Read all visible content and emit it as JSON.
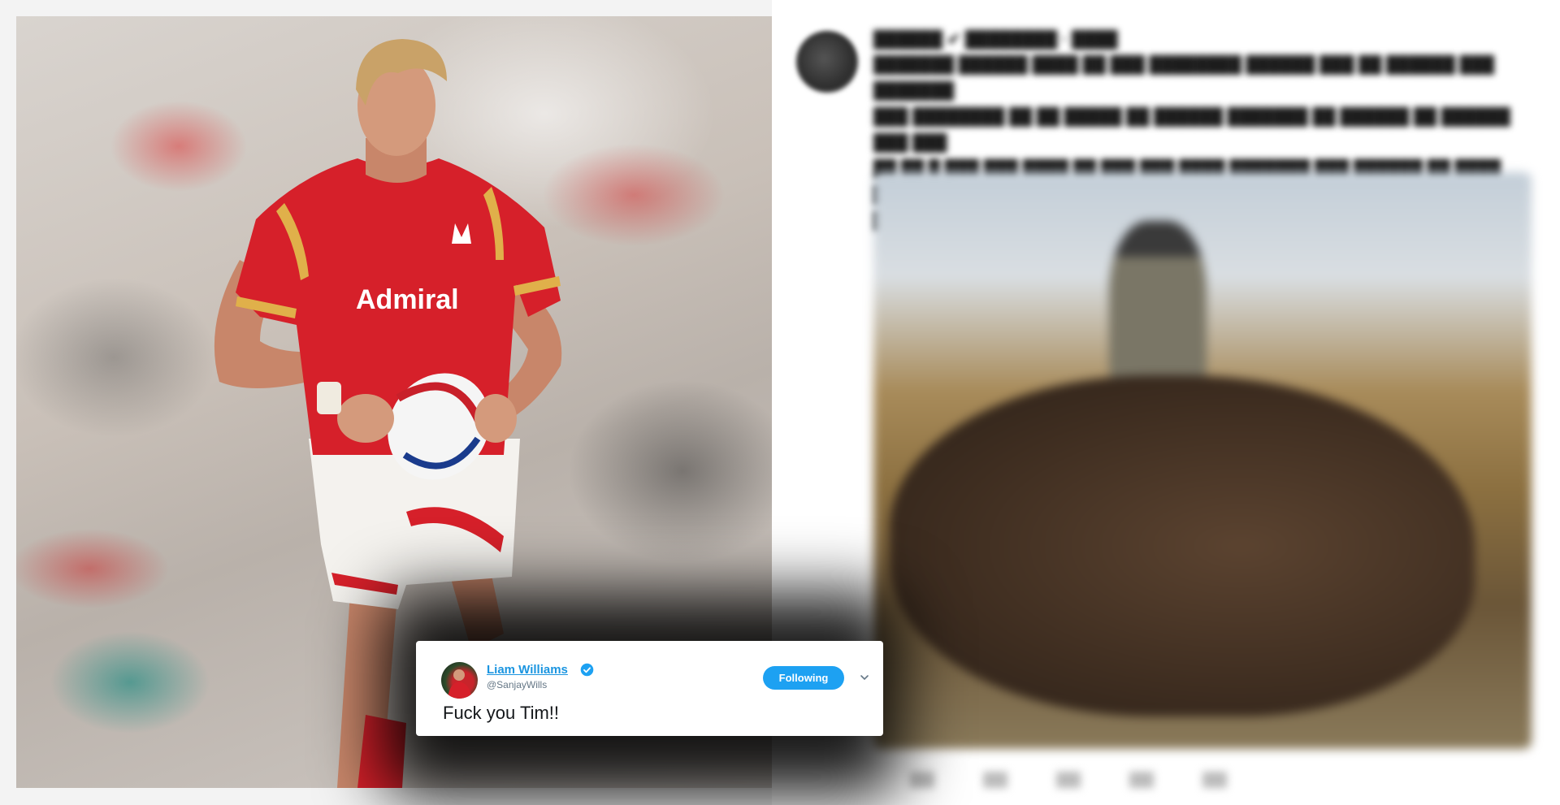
{
  "tweet": {
    "author_name": "Liam Williams",
    "author_handle": "@SanjayWills",
    "follow_label": "Following",
    "text": "Fuck you Tim!!",
    "verified_icon": "verified-badge-icon",
    "menu_icon": "chevron-down-icon"
  },
  "colors": {
    "link_blue": "#1b95e0",
    "button_blue": "#1da1f2",
    "jersey_red": "#d6202a",
    "handle_gray": "#657786"
  }
}
